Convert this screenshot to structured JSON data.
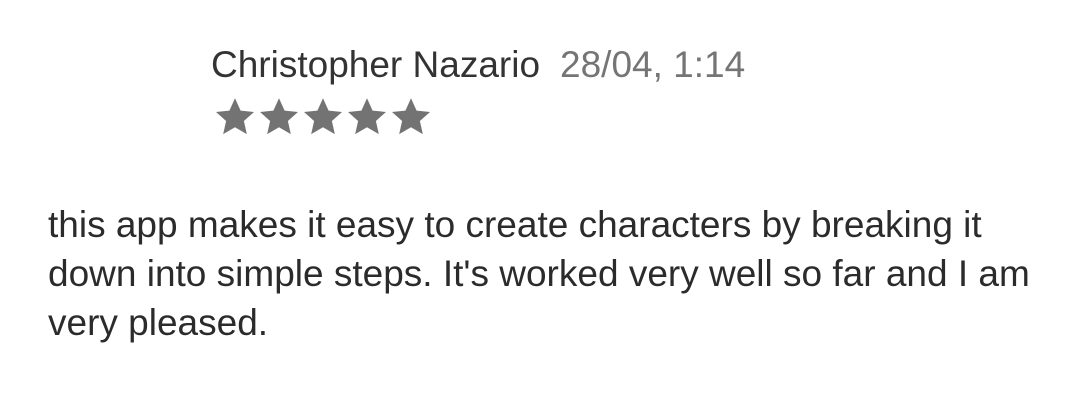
{
  "review": {
    "author": "Christopher Nazario",
    "timestamp": "28/04, 1:14",
    "rating": 5,
    "rating_max": 5,
    "star_icon": "star-icon",
    "star_color": "#737373",
    "text": "this app makes it easy to create characters by breaking it down into simple steps. It's worked very well so far and I am very pleased."
  }
}
